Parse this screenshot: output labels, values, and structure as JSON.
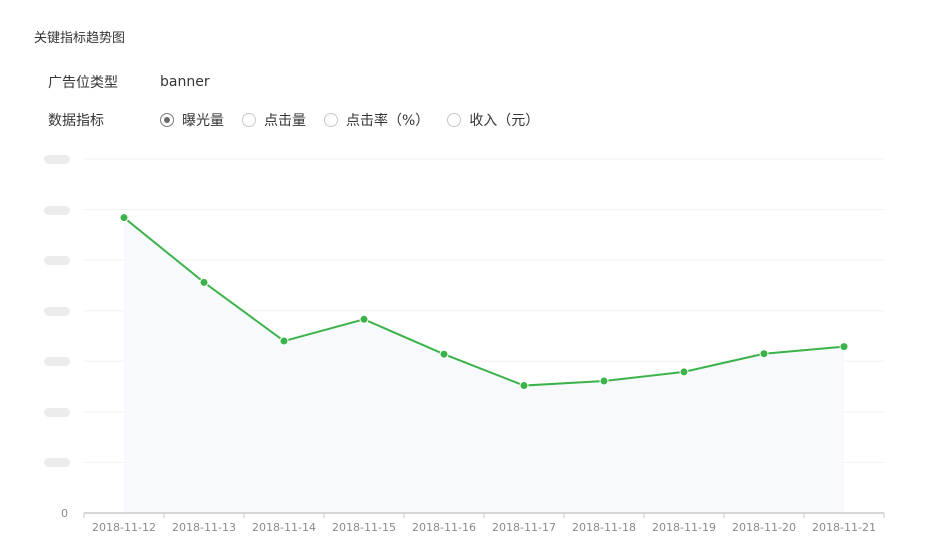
{
  "page_title": "关键指标趋势图",
  "filters": {
    "ad_type_label": "广告位类型",
    "ad_type_value": "banner",
    "metric_label": "数据指标",
    "metric_options": [
      {
        "label": "曝光量",
        "selected": true
      },
      {
        "label": "点击量",
        "selected": false
      },
      {
        "label": "点击率（%）",
        "selected": false
      },
      {
        "label": "收入（元）",
        "selected": false
      }
    ]
  },
  "chart_data": {
    "type": "line",
    "categories": [
      "2018-11-12",
      "2018-11-13",
      "2018-11-14",
      "2018-11-15",
      "2018-11-16",
      "2018-11-17",
      "2018-11-18",
      "2018-11-19",
      "2018-11-20",
      "2018-11-21"
    ],
    "series": [
      {
        "values": [
          5.84,
          4.56,
          3.4,
          3.83,
          3.14,
          2.52,
          2.61,
          2.79,
          3.15,
          3.29
        ],
        "color": "#3cb34a"
      }
    ],
    "y_axis": {
      "min": 0,
      "max": 7,
      "visible_tick_labels": [
        "0"
      ]
    },
    "grid": true,
    "area_fill_color": "#f8f9fc",
    "x_axis_color": "#c9c9c9",
    "grid_color": "#f0f0f0"
  }
}
